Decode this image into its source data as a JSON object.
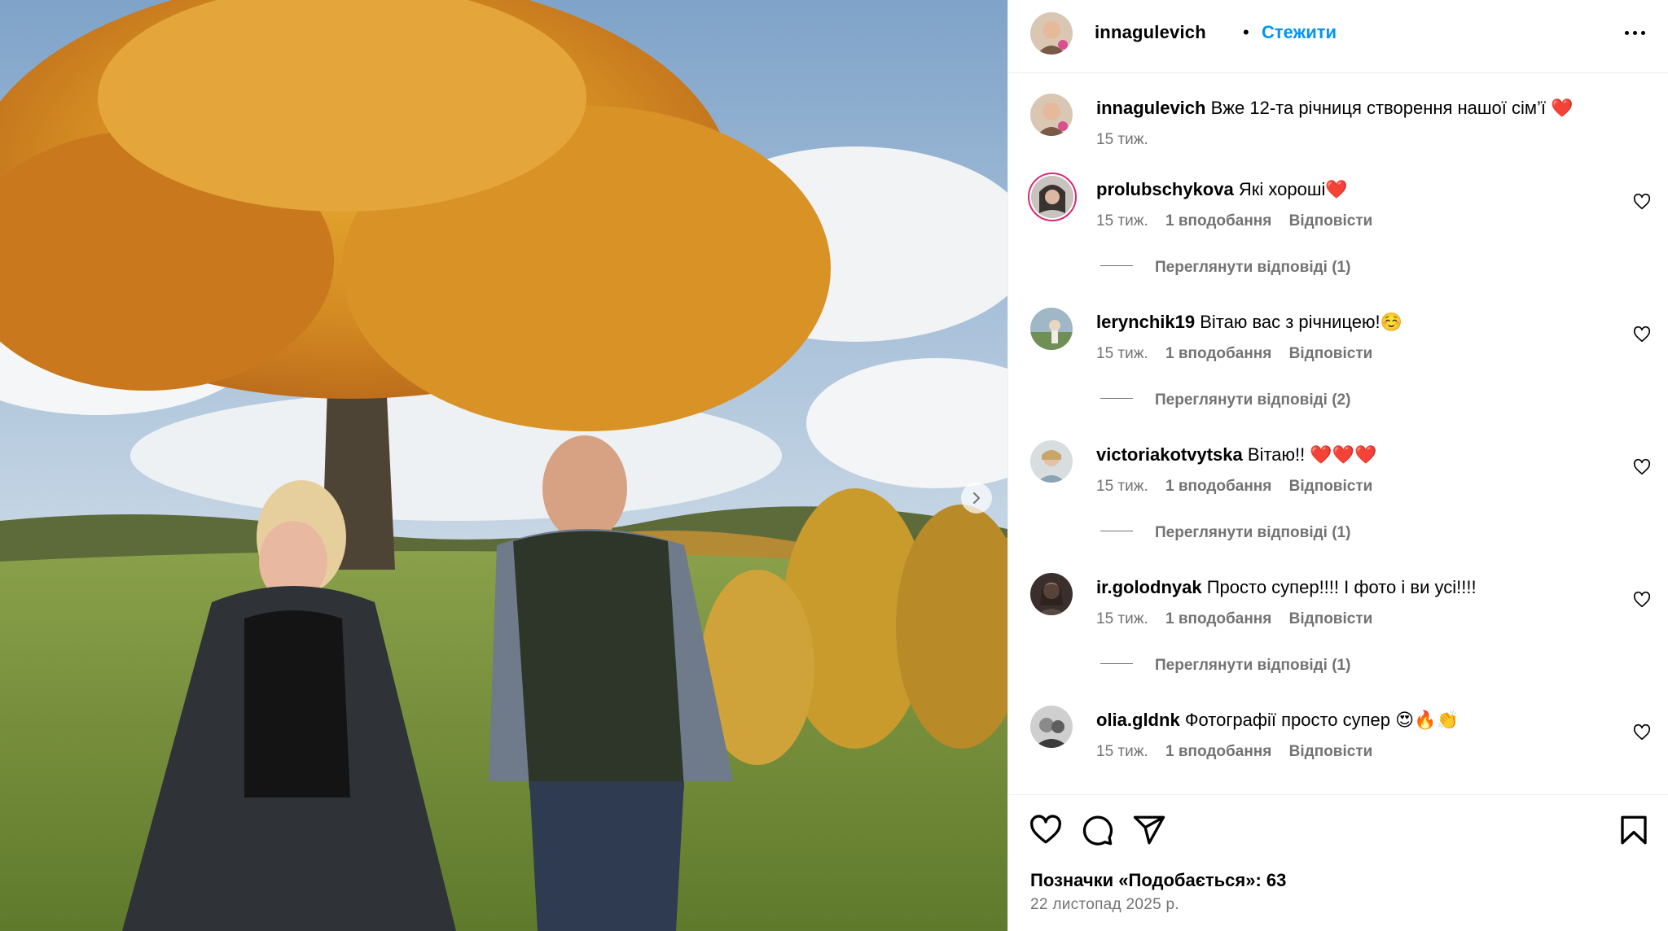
{
  "post": {
    "author": "innagulevich",
    "follow_label": "Стежити",
    "separator": "•",
    "photo_next_icon": "chevron-right-icon"
  },
  "caption": {
    "user": "innagulevich",
    "text": "Вже 12-та річниця створення нашої сім’ї",
    "emoji": "❤️",
    "time": "15 тиж."
  },
  "comments": [
    {
      "user": "prolubschykova",
      "text": "Які хороші",
      "emoji": "❤️",
      "time": "15 тиж.",
      "likes": "1 вподобання",
      "reply": "Відповісти",
      "view_replies": "Переглянути відповіді (1)"
    },
    {
      "user": "lerynchik19",
      "text": "Вітаю вас з річницею!",
      "emoji": "☺️",
      "time": "15 тиж.",
      "likes": "1 вподобання",
      "reply": "Відповісти",
      "view_replies": "Переглянути відповіді (2)"
    },
    {
      "user": "victoriakotvytska",
      "text": "Вітаю!!",
      "emoji": "❤️❤️❤️",
      "time": "15 тиж.",
      "likes": "1 вподобання",
      "reply": "Відповісти",
      "view_replies": "Переглянути відповіді (1)"
    },
    {
      "user": "ir.golodnyak",
      "text": "Просто супер!!!! І фото і ви усі!!!!",
      "emoji": "",
      "time": "15 тиж.",
      "likes": "1 вподобання",
      "reply": "Відповісти",
      "view_replies": "Переглянути відповіді (1)"
    },
    {
      "user": "olia.gldnk",
      "text": "Фотографії просто супер",
      "emoji": "😍🔥👏",
      "time": "15 тиж.",
      "likes": "1 вподобання",
      "reply": "Відповісти",
      "view_replies": ""
    }
  ],
  "actions": {
    "icons": [
      "heart-icon",
      "comment-icon",
      "share-icon",
      "bookmark-icon"
    ],
    "likes_label": "Позначки «Подобається»: 63",
    "date": "22 листопад 2025 р."
  },
  "colors": {
    "link": "#0095f6",
    "muted": "#737373",
    "border": "#efefef",
    "story_ring": "#d62976"
  }
}
